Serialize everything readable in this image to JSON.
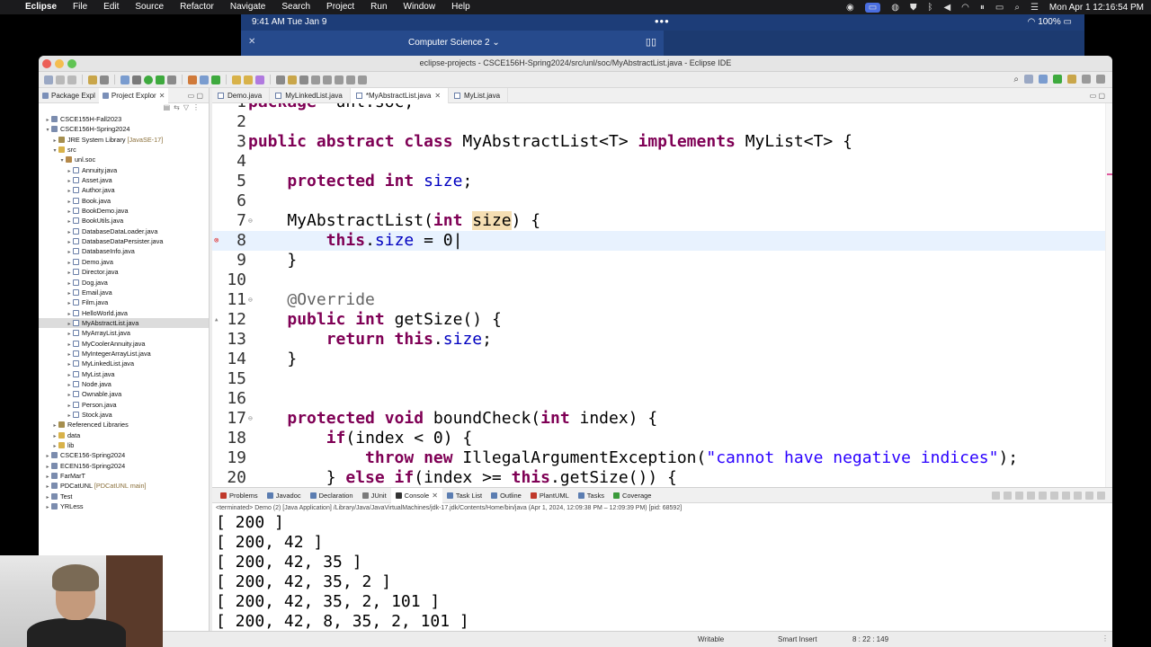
{
  "menubar": {
    "app": "Eclipse",
    "items": [
      "File",
      "Edit",
      "Source",
      "Refactor",
      "Navigate",
      "Search",
      "Project",
      "Run",
      "Window",
      "Help"
    ],
    "clock": "Mon Apr 1  12:16:54 PM",
    "icons": [
      "camera-icon",
      "sidecar-icon",
      "vpn-icon",
      "shield-icon",
      "bluetooth-icon",
      "volume-icon",
      "wifi-icon",
      "pause-icon",
      "battery-icon",
      "search-icon",
      "controls-icon"
    ]
  },
  "ipad": {
    "time": "9:41 AM   Tue Jan 9",
    "battery": "100%",
    "tab_title": "Computer Science 2",
    "dots": "•••"
  },
  "window": {
    "title": "eclipse-projects - CSCE156H-Spring2024/src/unl/soc/MyAbstractList.java - Eclipse IDE"
  },
  "left": {
    "tabs": [
      "Package Expl",
      "Project Explor"
    ],
    "tree": [
      {
        "depth": 0,
        "toggle": "›",
        "icon": "project",
        "label": "CSCE155H-Fall2023",
        "dec": ""
      },
      {
        "depth": 0,
        "toggle": "⌄",
        "icon": "project",
        "label": "CSCE156H-Spring2024",
        "dec": ""
      },
      {
        "depth": 1,
        "toggle": "›",
        "icon": "lib",
        "label": "JRE System Library",
        "dec": "[JavaSE-17]"
      },
      {
        "depth": 1,
        "toggle": "⌄",
        "icon": "folder",
        "label": "src",
        "dec": ""
      },
      {
        "depth": 2,
        "toggle": "⌄",
        "icon": "pkg",
        "label": "unl.soc",
        "dec": ""
      },
      {
        "depth": 3,
        "toggle": "›",
        "icon": "java",
        "label": "Annuity.java",
        "dec": ""
      },
      {
        "depth": 3,
        "toggle": "›",
        "icon": "java",
        "label": "Asset.java",
        "dec": ""
      },
      {
        "depth": 3,
        "toggle": "›",
        "icon": "java",
        "label": "Author.java",
        "dec": ""
      },
      {
        "depth": 3,
        "toggle": "›",
        "icon": "java",
        "label": "Book.java",
        "dec": ""
      },
      {
        "depth": 3,
        "toggle": "›",
        "icon": "java",
        "label": "BookDemo.java",
        "dec": ""
      },
      {
        "depth": 3,
        "toggle": "›",
        "icon": "java",
        "label": "BookUtils.java",
        "dec": ""
      },
      {
        "depth": 3,
        "toggle": "›",
        "icon": "java",
        "label": "DatabaseDataLoader.java",
        "dec": ""
      },
      {
        "depth": 3,
        "toggle": "›",
        "icon": "java",
        "label": "DatabaseDataPersister.java",
        "dec": ""
      },
      {
        "depth": 3,
        "toggle": "›",
        "icon": "java",
        "label": "DatabaseInfo.java",
        "dec": ""
      },
      {
        "depth": 3,
        "toggle": "›",
        "icon": "java",
        "label": "Demo.java",
        "dec": ""
      },
      {
        "depth": 3,
        "toggle": "›",
        "icon": "java",
        "label": "Director.java",
        "dec": ""
      },
      {
        "depth": 3,
        "toggle": "›",
        "icon": "java",
        "label": "Dog.java",
        "dec": ""
      },
      {
        "depth": 3,
        "toggle": "›",
        "icon": "java",
        "label": "Email.java",
        "dec": ""
      },
      {
        "depth": 3,
        "toggle": "›",
        "icon": "java",
        "label": "Film.java",
        "dec": ""
      },
      {
        "depth": 3,
        "toggle": "›",
        "icon": "java",
        "label": "HelloWorld.java",
        "dec": ""
      },
      {
        "depth": 3,
        "toggle": "›",
        "icon": "java",
        "label": "MyAbstractList.java",
        "dec": "",
        "selected": true
      },
      {
        "depth": 3,
        "toggle": "›",
        "icon": "java",
        "label": "MyArrayList.java",
        "dec": ""
      },
      {
        "depth": 3,
        "toggle": "›",
        "icon": "java",
        "label": "MyCoolerAnnuity.java",
        "dec": ""
      },
      {
        "depth": 3,
        "toggle": "›",
        "icon": "java",
        "label": "MyIntegerArrayList.java",
        "dec": ""
      },
      {
        "depth": 3,
        "toggle": "›",
        "icon": "java",
        "label": "MyLinkedList.java",
        "dec": ""
      },
      {
        "depth": 3,
        "toggle": "›",
        "icon": "java",
        "label": "MyList.java",
        "dec": ""
      },
      {
        "depth": 3,
        "toggle": "›",
        "icon": "java",
        "label": "Node.java",
        "dec": ""
      },
      {
        "depth": 3,
        "toggle": "›",
        "icon": "java",
        "label": "Ownable.java",
        "dec": ""
      },
      {
        "depth": 3,
        "toggle": "›",
        "icon": "java",
        "label": "Person.java",
        "dec": ""
      },
      {
        "depth": 3,
        "toggle": "›",
        "icon": "java",
        "label": "Stock.java",
        "dec": ""
      },
      {
        "depth": 1,
        "toggle": "›",
        "icon": "lib",
        "label": "Referenced Libraries",
        "dec": ""
      },
      {
        "depth": 1,
        "toggle": "›",
        "icon": "folder",
        "label": "data",
        "dec": ""
      },
      {
        "depth": 1,
        "toggle": "›",
        "icon": "folder",
        "label": "lib",
        "dec": ""
      },
      {
        "depth": 0,
        "toggle": "›",
        "icon": "project",
        "label": "CSCE156-Spring2024",
        "dec": ""
      },
      {
        "depth": 0,
        "toggle": "›",
        "icon": "project",
        "label": "ECEN156-Spring2024",
        "dec": ""
      },
      {
        "depth": 0,
        "toggle": "›",
        "icon": "project",
        "label": "FarMarT",
        "dec": ""
      },
      {
        "depth": 0,
        "toggle": "›",
        "icon": "project",
        "label": "PDCatUNL",
        "dec": "[PDCatUNL main]"
      },
      {
        "depth": 0,
        "toggle": "›",
        "icon": "project",
        "label": "Test",
        "dec": ""
      },
      {
        "depth": 0,
        "toggle": "›",
        "icon": "project",
        "label": "YRLess",
        "dec": ""
      }
    ]
  },
  "editor": {
    "tabs": [
      {
        "label": "Demo.java",
        "active": false,
        "close": false
      },
      {
        "label": "MyLinkedList.java",
        "active": false,
        "close": false
      },
      {
        "label": "*MyAbstractList.java",
        "active": true,
        "close": true
      },
      {
        "label": "MyList.java",
        "active": false,
        "close": false
      }
    ],
    "lines": [
      {
        "n": "1",
        "tokens": [
          [
            "kw",
            "package"
          ],
          [
            "",
            "  unl.soc;"
          ]
        ]
      },
      {
        "n": "2",
        "tokens": []
      },
      {
        "n": "3",
        "tokens": [
          [
            "kw",
            "public abstract class "
          ],
          [
            "",
            "MyAbstractList<T> "
          ],
          [
            "kw",
            "implements "
          ],
          [
            "",
            "MyList<T> {"
          ]
        ]
      },
      {
        "n": "4",
        "tokens": []
      },
      {
        "n": "5",
        "tokens": [
          [
            "",
            "    "
          ],
          [
            "kw",
            "protected int "
          ],
          [
            "fld",
            "size"
          ],
          [
            "",
            ";"
          ]
        ]
      },
      {
        "n": "6",
        "tokens": []
      },
      {
        "n": "7",
        "fold": "⊖",
        "tokens": [
          [
            "",
            "    MyAbstractList("
          ],
          [
            "kw",
            "int "
          ],
          [
            "occ",
            "size"
          ],
          [
            "",
            ") {"
          ]
        ]
      },
      {
        "n": "8",
        "marker": "error",
        "hl": true,
        "tokens": [
          [
            "",
            "        "
          ],
          [
            "kw",
            "this"
          ],
          [
            "",
            "."
          ],
          [
            "fld",
            "size"
          ],
          [
            "",
            " = 0"
          ]
        ]
      },
      {
        "n": "9",
        "tokens": [
          [
            "",
            "    }"
          ]
        ]
      },
      {
        "n": "10",
        "tokens": []
      },
      {
        "n": "11",
        "fold": "⊖",
        "tokens": [
          [
            "",
            "    "
          ],
          [
            "ann",
            "@Override"
          ]
        ]
      },
      {
        "n": "12",
        "marker": "override",
        "tokens": [
          [
            "",
            "    "
          ],
          [
            "kw",
            "public int "
          ],
          [
            "",
            "getSize() {"
          ]
        ]
      },
      {
        "n": "13",
        "tokens": [
          [
            "",
            "        "
          ],
          [
            "kw",
            "return this"
          ],
          [
            "",
            "."
          ],
          [
            "fld",
            "size"
          ],
          [
            "",
            ";"
          ]
        ]
      },
      {
        "n": "14",
        "tokens": [
          [
            "",
            "    }"
          ]
        ]
      },
      {
        "n": "15",
        "tokens": []
      },
      {
        "n": "16",
        "tokens": []
      },
      {
        "n": "17",
        "fold": "⊖",
        "tokens": [
          [
            "",
            "    "
          ],
          [
            "kw",
            "protected void "
          ],
          [
            "",
            "boundCheck("
          ],
          [
            "kw",
            "int "
          ],
          [
            "",
            "index) {"
          ]
        ]
      },
      {
        "n": "18",
        "tokens": [
          [
            "",
            "        "
          ],
          [
            "kw",
            "if"
          ],
          [
            "",
            "(index < 0) {"
          ]
        ]
      },
      {
        "n": "19",
        "tokens": [
          [
            "",
            "            "
          ],
          [
            "kw",
            "throw new "
          ],
          [
            "",
            "IllegalArgumentException("
          ],
          [
            "str",
            "\"cannot have negative indices\""
          ],
          [
            "",
            ");"
          ]
        ]
      },
      {
        "n": "20",
        "tokens": [
          [
            "",
            "        } "
          ],
          [
            "kw",
            "else if"
          ],
          [
            "",
            "(index >= "
          ],
          [
            "kw",
            "this"
          ],
          [
            "",
            ".getSize()) {"
          ]
        ]
      }
    ]
  },
  "console": {
    "tabs": [
      {
        "label": "Problems",
        "active": false,
        "color": "#c0392b"
      },
      {
        "label": "Javadoc",
        "active": false,
        "color": "#5b7db1"
      },
      {
        "label": "Declaration",
        "active": false,
        "color": "#5b7db1"
      },
      {
        "label": "JUnit",
        "active": false,
        "color": "#7a7a7a"
      },
      {
        "label": "Console",
        "active": true,
        "color": "#333333"
      },
      {
        "label": "Task List",
        "active": false,
        "color": "#5b7db1"
      },
      {
        "label": "Outline",
        "active": false,
        "color": "#5b7db1"
      },
      {
        "label": "PlantUML",
        "active": false,
        "color": "#c0392b"
      },
      {
        "label": "Tasks",
        "active": false,
        "color": "#5b7db1"
      },
      {
        "label": "Coverage",
        "active": false,
        "color": "#3a9a3a"
      }
    ],
    "terminated": "<terminated> Demo (2) [Java Application] /Library/Java/JavaVirtualMachines/jdk-17.jdk/Contents/Home/bin/java  (Apr 1, 2024, 12:09:38 PM – 12:09:39 PM) [pid: 68592]",
    "output": [
      "[ 200 ]",
      "[ 200, 42 ]",
      "[ 200, 42, 35 ]",
      "[ 200, 42, 35, 2 ]",
      "[ 200, 42, 35, 2, 101 ]",
      "[ 200, 42, 8, 35, 2, 101 ]"
    ]
  },
  "status": {
    "mode": "Writable",
    "insert": "Smart Insert",
    "position": "8 : 22 : 149"
  }
}
